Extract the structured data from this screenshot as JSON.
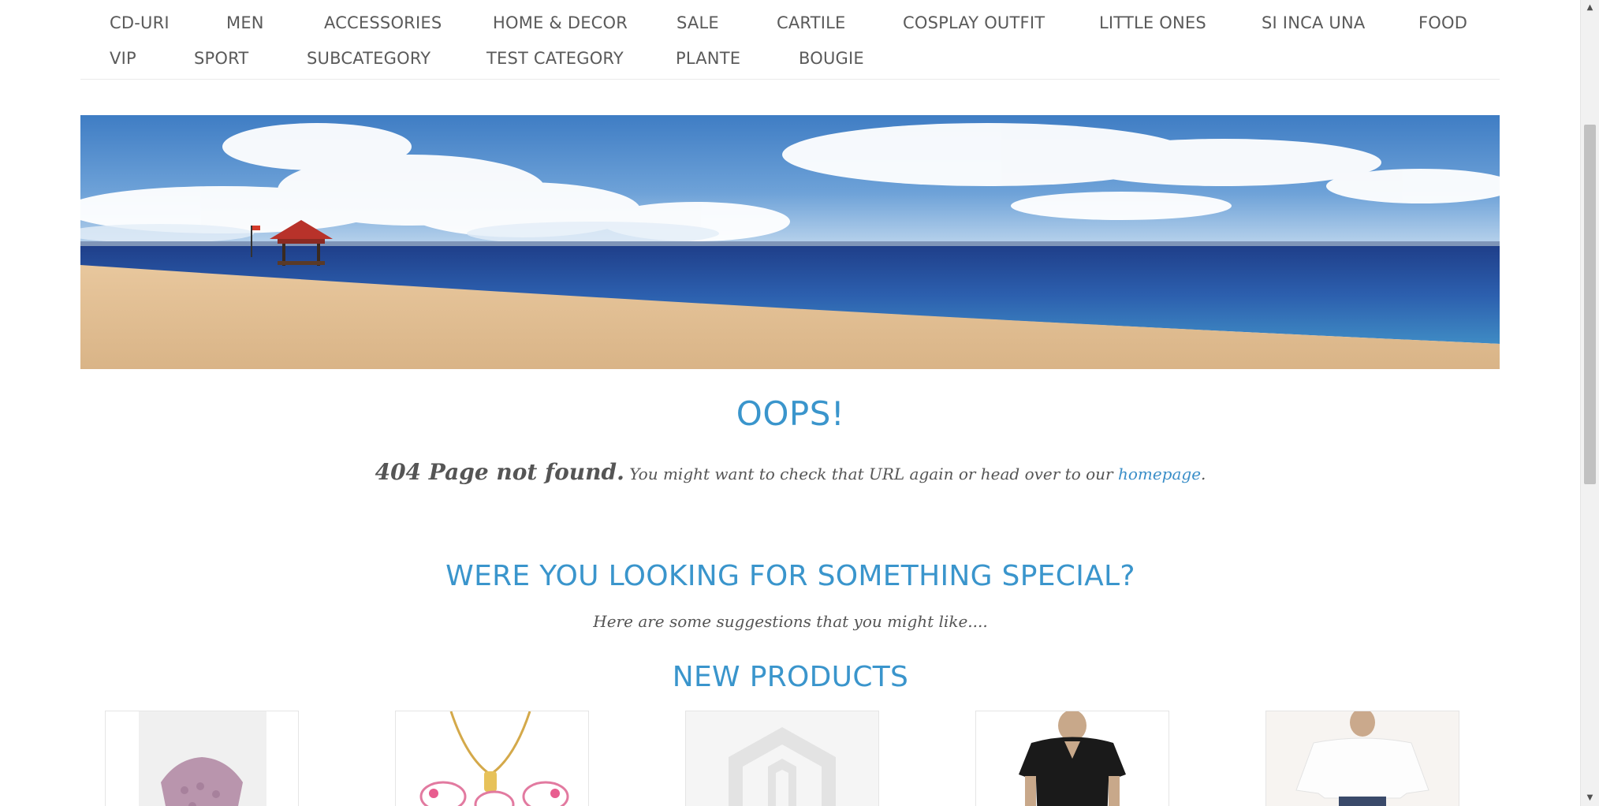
{
  "nav": {
    "row1": [
      "CD-URI",
      "MEN",
      "ACCESSORIES",
      "HOME & DECOR",
      "SALE",
      "CARTILE",
      "COSPLAY OUTFIT",
      "LITTLE ONES",
      "SI INCA UNA",
      "FOOD"
    ],
    "row2": [
      "VIP",
      "SPORT",
      "SUBCATEGORY",
      "TEST CATEGORY",
      "PLANTE",
      "BOUGIE"
    ]
  },
  "error": {
    "heading": "OOPS!",
    "code_text": "404 Page not found.",
    "message": " You might want to check that URL again or head over to our ",
    "link_text": "homepage",
    "period": "."
  },
  "suggestions": {
    "heading": "WERE YOU LOOKING FOR SOMETHING SPECIAL?",
    "subtitle": "Here are some suggestions that you might like...."
  },
  "new_products": {
    "heading": "NEW PRODUCTS"
  },
  "colors": {
    "accent": "#3a95cc",
    "text": "#555555"
  },
  "icons": {
    "scroll_up": "caret-up-icon",
    "scroll_down": "caret-down-icon"
  }
}
